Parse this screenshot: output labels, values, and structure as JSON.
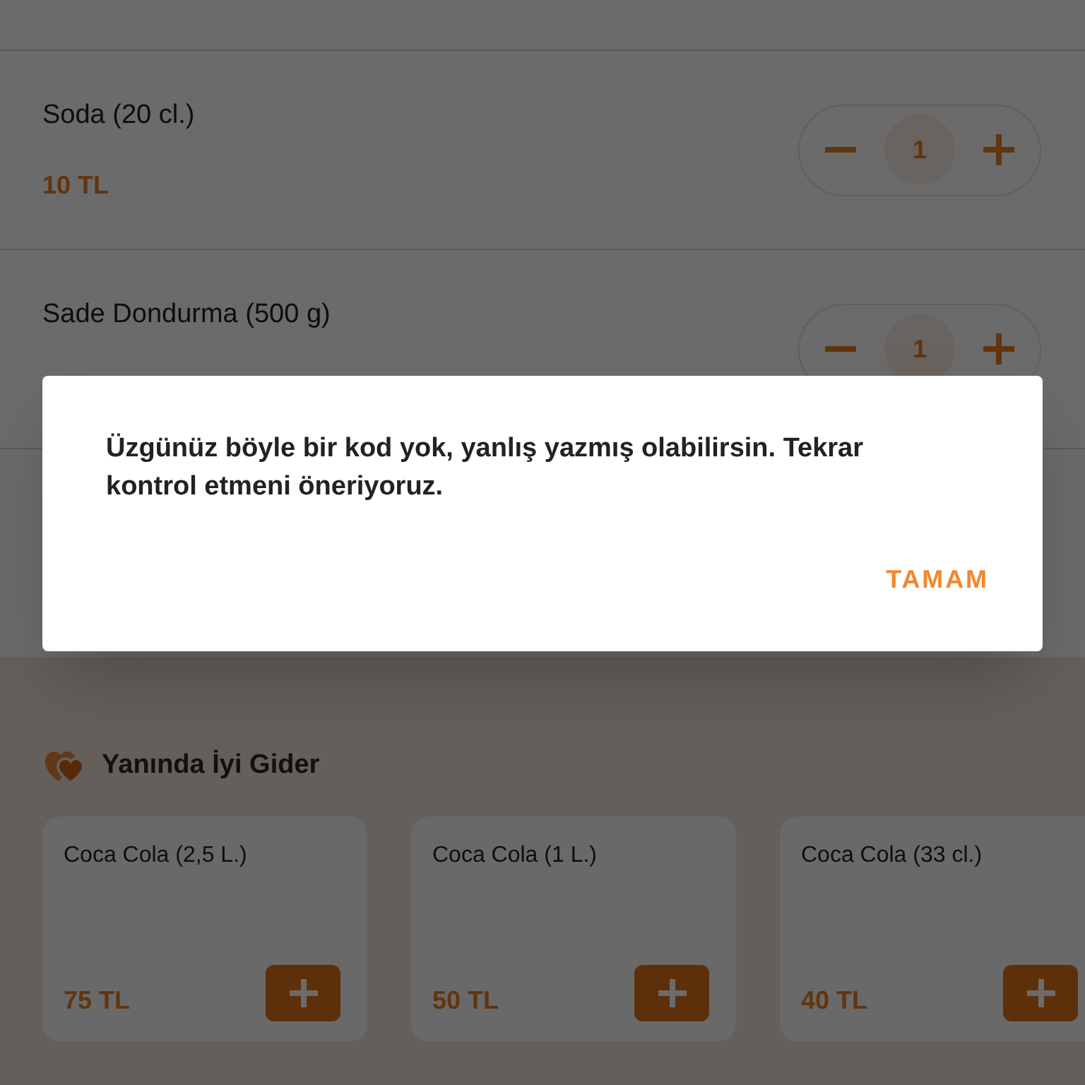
{
  "cart_items": [
    {
      "name": "Soda (20 cl.)",
      "price": "10 TL",
      "quantity": "1"
    },
    {
      "name": "Sade Dondurma (500 g)",
      "quantity": "1"
    }
  ],
  "suggestions": {
    "title": "Yanında İyi Gider",
    "items": [
      {
        "name": "Coca Cola (2,5 L.)",
        "price": "75 TL"
      },
      {
        "name": "Coca Cola (1 L.)",
        "price": "50 TL"
      },
      {
        "name": "Coca Cola (33 cl.)",
        "price": "40 TL"
      }
    ]
  },
  "dialog": {
    "message": "Üzgünüz böyle bir kod yok, yanlış yazmış olabilirsin. Tekrar kontrol etmeni öneriyoruz.",
    "button": "TAMAM"
  }
}
